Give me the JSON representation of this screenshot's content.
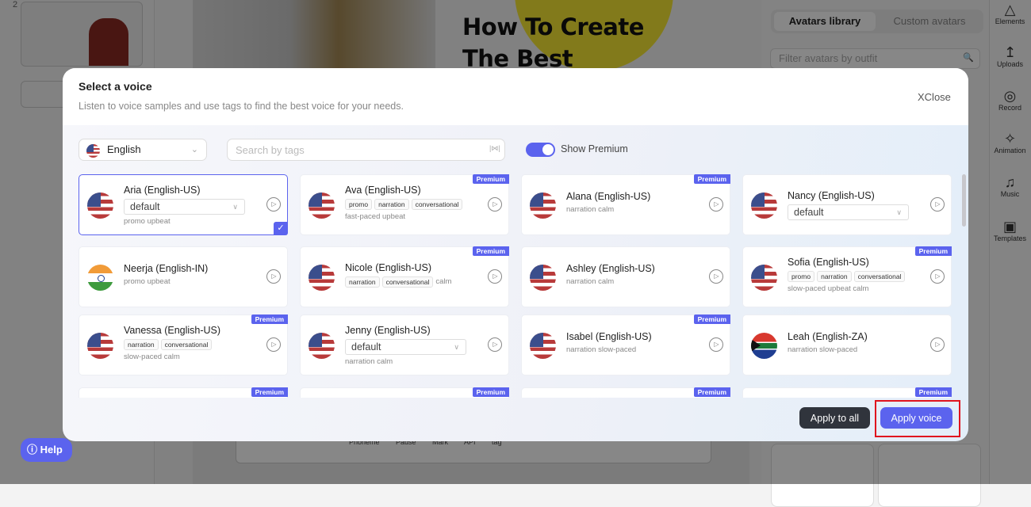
{
  "background": {
    "slide_number": "2",
    "add_slide": "+",
    "canvas_title": "How To Create The Best",
    "avatar_tabs": [
      "Avatars library",
      "Custom avatars"
    ],
    "avatar_filter_placeholder": "Filter avatars by outfit",
    "rail": [
      {
        "label": "Elements",
        "icon": "shapes-icon"
      },
      {
        "label": "Uploads",
        "icon": "upload-icon"
      },
      {
        "label": "Record",
        "icon": "record-icon"
      },
      {
        "label": "Animation",
        "icon": "sparkle-icon"
      },
      {
        "label": "Music",
        "icon": "music-icon"
      },
      {
        "label": "Templates",
        "icon": "image-icon"
      }
    ],
    "editor_tools": "Phoneme Pause Mark API tag",
    "help": "Help"
  },
  "modal": {
    "title": "Select a voice",
    "subtitle": "Listen to voice samples and use tags to find the best voice for your needs.",
    "close": "Close",
    "language": "English",
    "search_placeholder": "Search by tags",
    "show_premium_label": "Show Premium",
    "show_premium": true,
    "premium_badge": "Premium",
    "accent_color": "#5b63ee",
    "voices": [
      {
        "name": "Aria (English-US)",
        "flag": "us",
        "style": "default",
        "desc": "promo upbeat",
        "selected": true,
        "premium": false
      },
      {
        "name": "Ava (English-US)",
        "flag": "us",
        "tags": [
          "promo",
          "narration",
          "conversational"
        ],
        "desc": "fast-paced upbeat",
        "premium": true
      },
      {
        "name": "Alana (English-US)",
        "flag": "us",
        "desc": "narration calm",
        "premium": true
      },
      {
        "name": "Nancy (English-US)",
        "flag": "us",
        "style": "default",
        "premium": false
      },
      {
        "name": "Neerja (English-IN)",
        "flag": "in",
        "desc": "promo upbeat",
        "premium": false
      },
      {
        "name": "Nicole (English-US)",
        "flag": "us",
        "tags": [
          "narration",
          "conversational"
        ],
        "inline_desc": "calm",
        "premium": true
      },
      {
        "name": "Ashley (English-US)",
        "flag": "us",
        "desc": "narration calm",
        "premium": false
      },
      {
        "name": "Sofia (English-US)",
        "flag": "us",
        "tags": [
          "promo",
          "narration",
          "conversational"
        ],
        "desc": "slow-paced upbeat calm",
        "premium": true
      },
      {
        "name": "Vanessa (English-US)",
        "flag": "us",
        "tags": [
          "narration",
          "conversational"
        ],
        "desc": "slow-paced calm",
        "premium": true
      },
      {
        "name": "Jenny (English-US)",
        "flag": "us",
        "style": "default",
        "desc": "narration calm",
        "premium": false
      },
      {
        "name": "Isabel (English-US)",
        "flag": "us",
        "desc": "narration slow-paced",
        "premium": true
      },
      {
        "name": "Leah (English-ZA)",
        "flag": "za",
        "desc": "narration slow-paced",
        "premium": false
      },
      {
        "premium": true
      },
      {
        "premium": true
      },
      {
        "premium": true
      },
      {
        "premium": true
      }
    ],
    "apply_all": "Apply to all",
    "apply_voice": "Apply voice"
  }
}
